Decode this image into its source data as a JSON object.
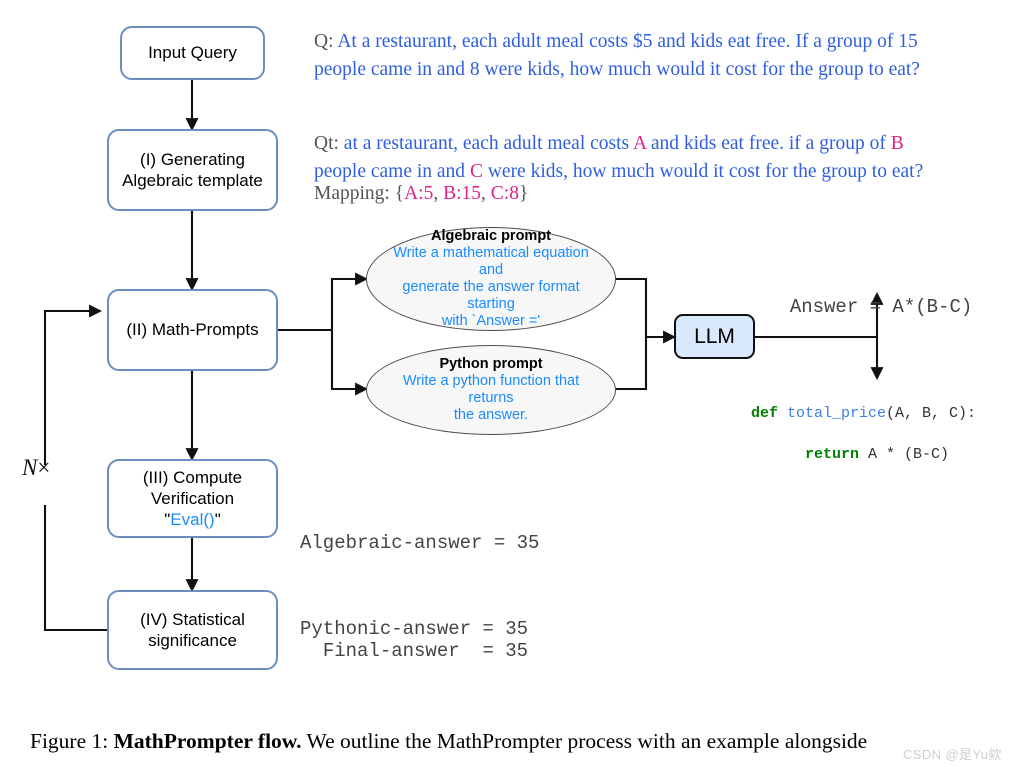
{
  "figure": {
    "caption_prefix": "Figure 1:",
    "caption_bold": "MathPrompter flow.",
    "caption_rest": "We outline the MathPrompter process with an example alongside",
    "watermark": "CSDN @是Yu欸"
  },
  "flow": {
    "input_query": "Input Query",
    "step1_line1": "(I) Generating",
    "step1_line2": "Algebraic template",
    "step2": "(II) Math-Prompts",
    "step3_line1": "(III) Compute",
    "step3_line2": "Verification",
    "step3_line3_quote_open": "\"",
    "step3_line3_eval": "Eval()",
    "step3_line3_quote_close": "\"",
    "step4_line1": "(IV) Statistical",
    "step4_line2": "significance",
    "llm": "LLM",
    "loop_label_n": "N",
    "loop_label_times": "×"
  },
  "prompts": {
    "algebraic": {
      "title": "Algebraic prompt",
      "line1": "Write a mathematical equation and",
      "line2": "generate the answer format starting",
      "line3": "with `Answer ='"
    },
    "python": {
      "title": "Python prompt",
      "line1": "Write a python function that returns",
      "line2": "the answer."
    }
  },
  "example": {
    "q_label": "Q:",
    "q_line1": "At a restaurant, each adult meal costs $5 and kids eat free.  If a group of 15",
    "q_line2": "people came in and 8 were kids, how much would it cost for the group to eat?",
    "qt_label": "Qt:",
    "qt_seg1": "at a restaurant, each adult meal costs ",
    "qt_var_a": "A",
    "qt_seg2": " and kids eat free.  if a group of ",
    "qt_var_b": "B",
    "qt_seg3": "people came in and ",
    "qt_var_c": "C",
    "qt_seg4": " were kids, how much would it cost for the group to eat?",
    "mapping_label": "Mapping: {",
    "mapping_a": "A:5",
    "mapping_sep1": ", ",
    "mapping_b": "B:15",
    "mapping_sep2": ", ",
    "mapping_c": "C:8",
    "mapping_close": "}"
  },
  "outputs": {
    "answer_equation": "Answer = A*(B-C)",
    "code_kw_def": "def",
    "code_fn_name": " total_price",
    "code_sig": "(A, B, C):",
    "code_kw_return": "return",
    "code_expr": " A * (B-C)",
    "algebraic_answer": "Algebraic-answer = 35",
    "pythonic_answer": "Pythonic-answer = 35",
    "final_answer": "Final-answer  = 35"
  },
  "colors": {
    "box_border": "#6c8ebf",
    "llm_fill": "#dae8fc",
    "prompt_text": "#1a8cff",
    "question_blue": "#2f5fe0",
    "variable_magenta": "#e0218a",
    "code_keyword_green": "#008000",
    "code_function_blue": "#3f7fdf"
  }
}
